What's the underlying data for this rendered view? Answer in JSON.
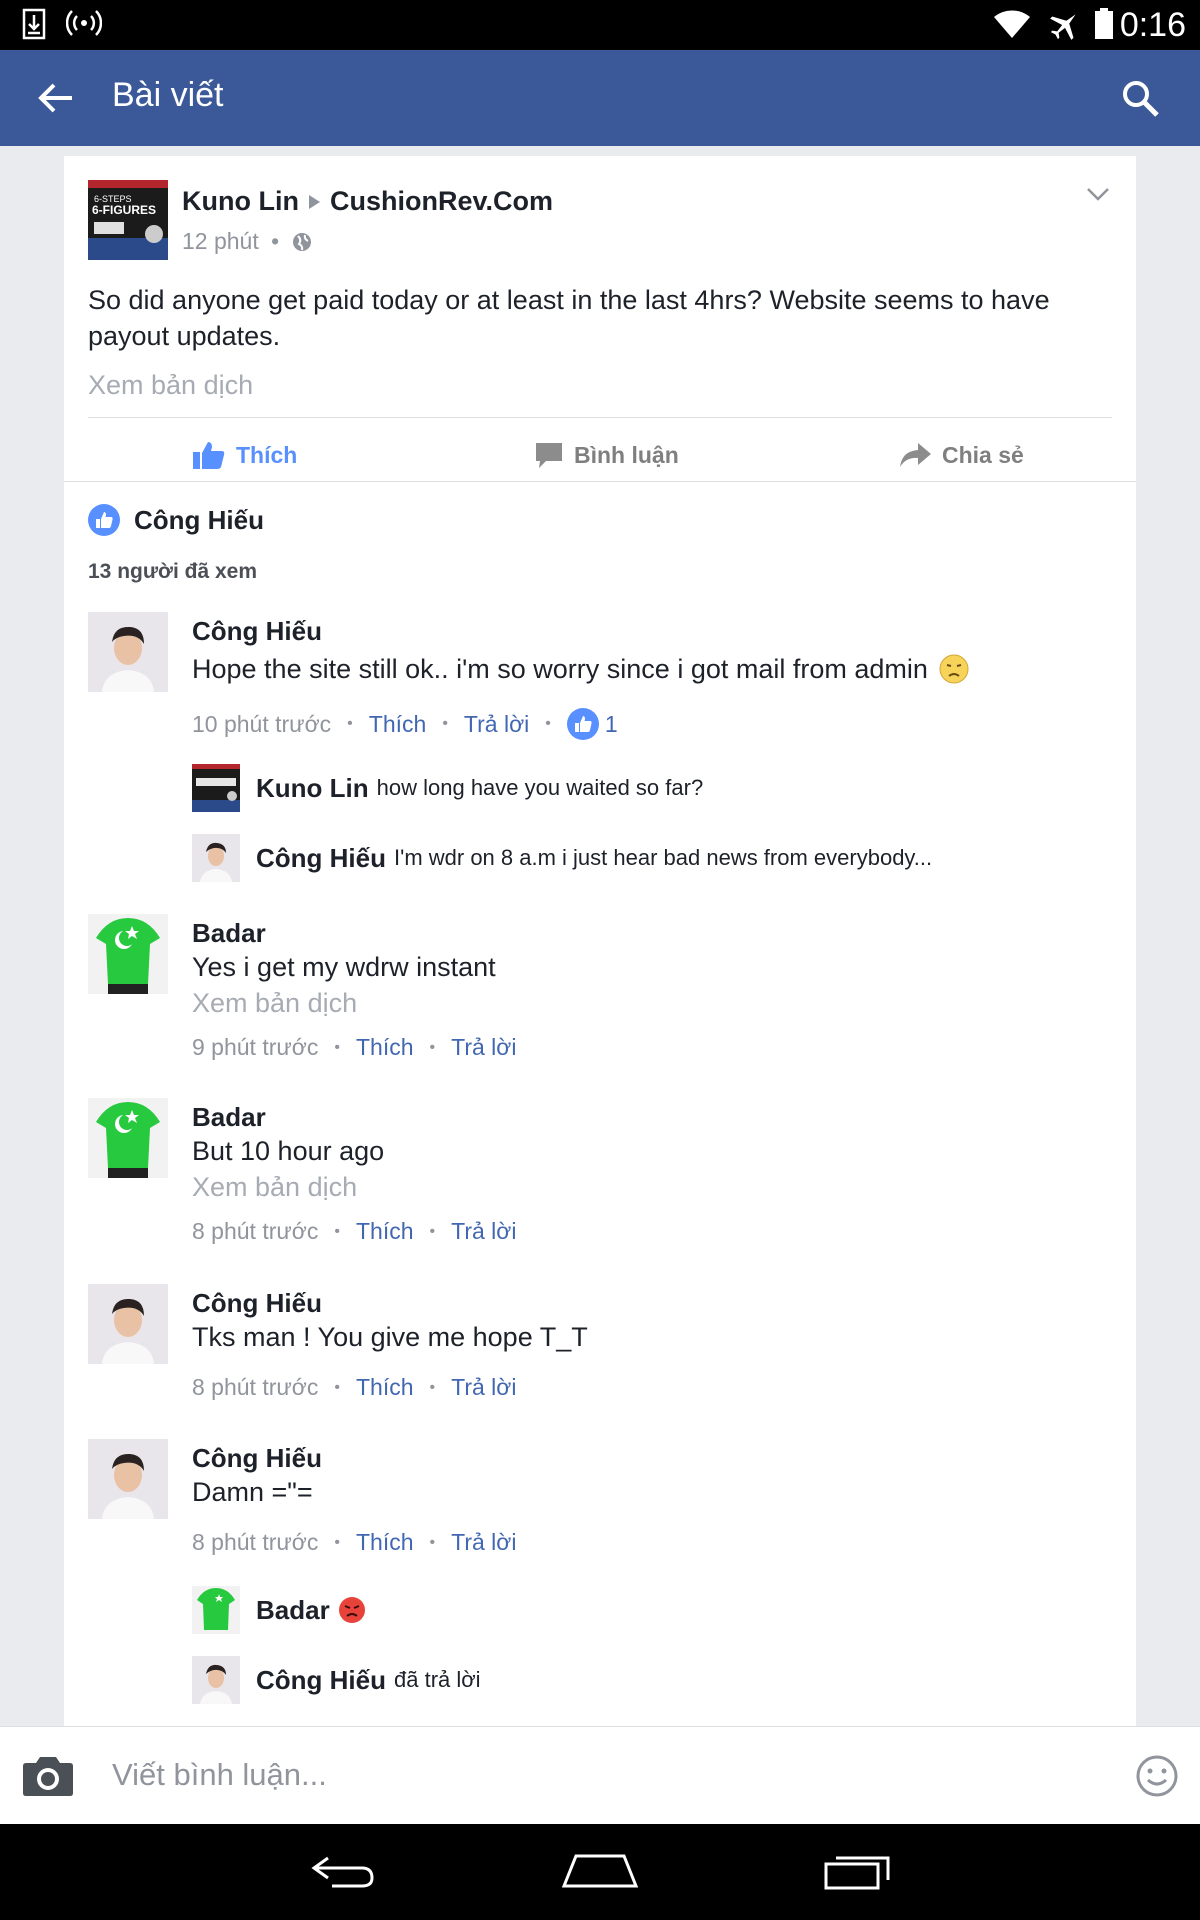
{
  "status_bar": {
    "time": "0:16"
  },
  "app_bar": {
    "title": "Bài viết"
  },
  "post": {
    "author": "Kuno Lin",
    "group": "CushionRev.Com",
    "time": "12 phút",
    "sep": "•",
    "text": "So did anyone get paid today or at least in the last 4hrs? Website seems to have payout updates.",
    "see_translation": "Xem bản dịch",
    "avatar_text": {
      "line1": "6-STEPS",
      "line2": "6-FIGURES"
    },
    "actions": {
      "like": "Thích",
      "comment": "Bình luận",
      "share": "Chia sẻ"
    },
    "liker": "Công Hiếu",
    "seen_count": "13 người đã xem"
  },
  "comments": [
    {
      "name": "Công Hiếu",
      "text": "Hope the site still ok.. i'm so worry since i got mail from admin",
      "time": "10 phút trước",
      "like": "Thích",
      "reply": "Trả lời",
      "likes": "1"
    },
    {
      "name": "Kuno Lin",
      "text": "how long have you waited so far?"
    },
    {
      "name": "Công Hiếu",
      "text": "I'm wdr on 8 a.m i just hear bad news from everybody..."
    },
    {
      "name": "Badar",
      "text": "Yes i get my wdrw instant",
      "see_translation": "Xem bản dịch",
      "time": "9 phút trước",
      "like": "Thích",
      "reply": "Trả lời"
    },
    {
      "name": "Badar",
      "text": "But 10 hour ago",
      "see_translation": "Xem bản dịch",
      "time": "8 phút trước",
      "like": "Thích",
      "reply": "Trả lời"
    },
    {
      "name": "Công Hiếu",
      "text": "Tks man ! You give me hope T_T",
      "time": "8 phút trước",
      "like": "Thích",
      "reply": "Trả lời"
    },
    {
      "name": "Công Hiếu",
      "text": "Damn =\"=",
      "time": "8 phút trước",
      "like": "Thích",
      "reply": "Trả lời"
    },
    {
      "name": "Badar"
    },
    {
      "name": "Công Hiếu",
      "text": "đã trả lời"
    }
  ],
  "composer": {
    "placeholder": "Viết bình luận..."
  },
  "colors": {
    "brand": "#3b5998",
    "link": "#4267b2",
    "like_blue": "#5890ff"
  }
}
